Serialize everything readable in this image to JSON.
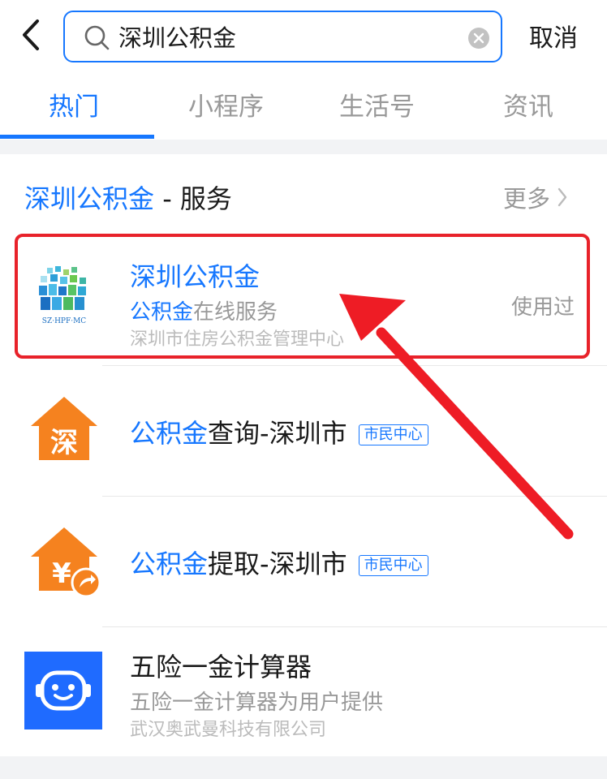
{
  "header": {
    "search_value": "深圳公积金",
    "cancel_label": "取消"
  },
  "tabs": [
    {
      "label": "热门",
      "active": true
    },
    {
      "label": "小程序",
      "active": false
    },
    {
      "label": "生活号",
      "active": false
    },
    {
      "label": "资讯",
      "active": false
    }
  ],
  "section": {
    "title_highlight": "深圳公积金",
    "title_rest": " - 服务",
    "more_label": "更多"
  },
  "results": [
    {
      "title": "深圳公积金",
      "sub_highlight": "公积金",
      "sub_rest": "在线服务",
      "org": "深圳市住房公积金管理中心",
      "used_label": "使用过",
      "logo_text": "SZ·HPF·MC",
      "icon": "szhpfmc-logo-icon"
    },
    {
      "title_highlight": "公积金",
      "title_rest": "查询-深圳市",
      "tag": "市民中心",
      "icon_char": "深",
      "icon": "house-shen-icon"
    },
    {
      "title_highlight": "公积金",
      "title_rest": "提取-深圳市",
      "tag": "市民中心",
      "icon_char": "¥",
      "icon": "house-yuan-share-icon"
    },
    {
      "title": "五险一金计算器",
      "sub": "五险一金计算器为用户提供",
      "org": "武汉奥武曼科技有限公司",
      "icon": "robot-face-icon"
    }
  ],
  "colors": {
    "accent": "#1677ff",
    "highlight_box": "#e8222a",
    "icon_orange": "#f5821f",
    "icon_blue": "#1f6bff"
  }
}
